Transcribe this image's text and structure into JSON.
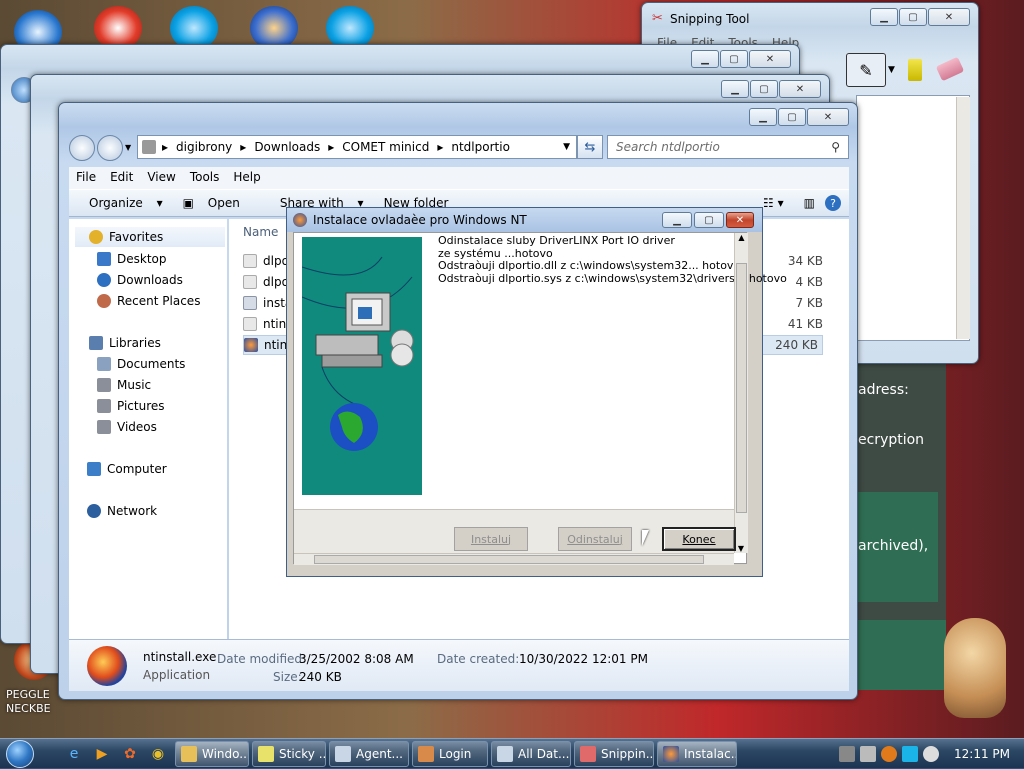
{
  "desktop": {
    "shortcut_label": [
      "PEGGLE",
      "NECKBE"
    ],
    "background_text": [
      "adress:",
      "ecryption",
      "archived),"
    ]
  },
  "snipping": {
    "title": "Snipping Tool",
    "menu": [
      "File",
      "Edit",
      "Tools",
      "Help"
    ]
  },
  "explorer": {
    "breadcrumb": [
      "digibrony",
      "Downloads",
      "COMET minicd",
      "ntdlportio"
    ],
    "search_placeholder": "Search ntdlportio",
    "menu": [
      "File",
      "Edit",
      "View",
      "Tools",
      "Help"
    ],
    "commands": {
      "organize": "Organize",
      "open": "Open",
      "share": "Share with",
      "new_folder": "New folder"
    },
    "column_name": "Name",
    "nav": {
      "favorites": "Favorites",
      "desktop": "Desktop",
      "downloads": "Downloads",
      "recent": "Recent Places",
      "libraries": "Libraries",
      "documents": "Documents",
      "music": "Music",
      "pictures": "Pictures",
      "videos": "Videos",
      "computer": "Computer",
      "network": "Network"
    },
    "files": [
      {
        "name": "dlpo",
        "size": "34 KB"
      },
      {
        "name": "dlpo",
        "size": "4 KB"
      },
      {
        "name": "insta",
        "size": "7 KB"
      },
      {
        "name": "ntin",
        "size": "41 KB"
      },
      {
        "name": "ntin",
        "size": "240 KB"
      }
    ],
    "details": {
      "filename": "ntinstall.exe",
      "type": "Application",
      "modified_label": "Date modified:",
      "modified_value": "3/25/2002 8:08 AM",
      "size_label": "Size:",
      "size_value": "240 KB",
      "created_label": "Date created:",
      "created_value": "10/30/2022 12:01 PM"
    }
  },
  "dialog": {
    "title": "Instalace ovladaèe pro Windows NT",
    "log": [
      "Odinstalace sluby DriverLINX Port IO driver",
      "ze systému ...hotovo",
      "Odstraòuji dlportio.dll z c:\\windows\\system32... hotovo",
      "Odstraòuji dlportio.sys z c:\\windows\\system32\\drivers... hotovo"
    ],
    "buttons": {
      "install": "Instaluj",
      "uninstall": "Odinstaluj",
      "finish": "Konec"
    }
  },
  "taskbar": {
    "tasks": [
      "Windo...",
      "Sticky ...",
      "Agent...",
      "Login",
      "All Dat...",
      "Snippin...",
      "Instalac..."
    ],
    "clock": "12:11 PM"
  }
}
